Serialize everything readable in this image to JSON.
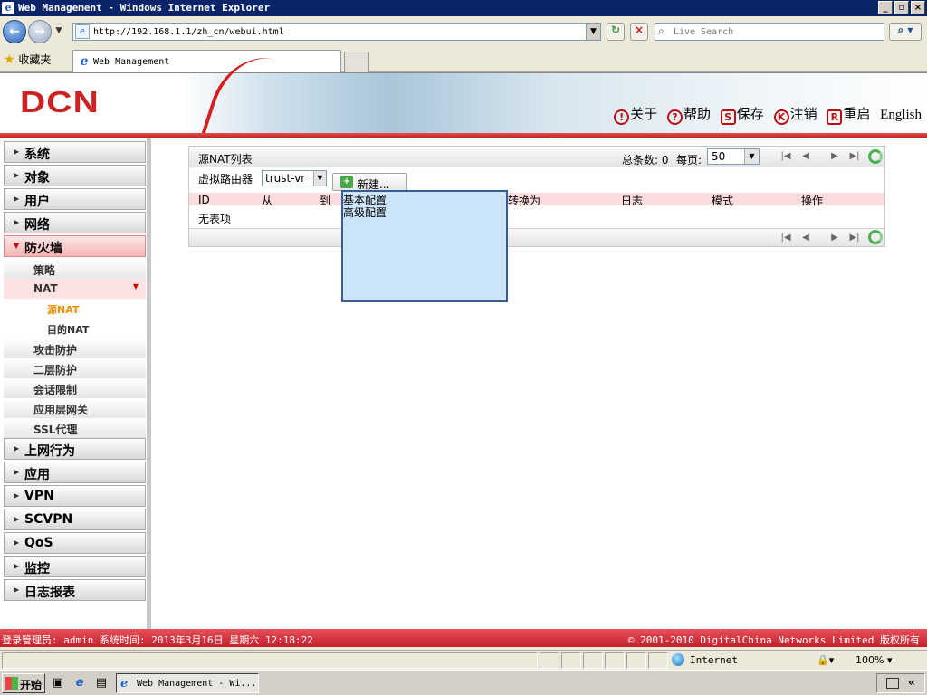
{
  "window": {
    "title": "Web Management - Windows Internet Explorer"
  },
  "browser": {
    "address": "http://192.168.1.1/zh_cn/webui.html",
    "search_placeholder": "Live Search",
    "favorites_label": "收藏夹",
    "tab_label": "Web Management"
  },
  "app": {
    "logo": "DCN",
    "header_links": [
      {
        "label": "关于",
        "icon": "!"
      },
      {
        "label": "帮助",
        "icon": "?"
      },
      {
        "label": "保存",
        "icon": "S"
      },
      {
        "label": "注销",
        "icon": "K"
      },
      {
        "label": "重启",
        "icon": "R"
      },
      {
        "label": "English"
      }
    ]
  },
  "sidebar": {
    "top_items": [
      "系统",
      "对象",
      "用户",
      "网络"
    ],
    "active_item": "防火墙",
    "firewall_subitems": [
      "策略",
      "NAT",
      "攻击防护",
      "二层防护",
      "会话限制",
      "应用层网关",
      "SSL代理"
    ],
    "nat_subitems": [
      "源NAT",
      "目的NAT"
    ],
    "bottom_items": [
      "上网行为",
      "应用",
      "VPN",
      "SCVPN",
      "QoS",
      "监控",
      "日志报表"
    ]
  },
  "panel": {
    "title": "源NAT列表",
    "total_label": "总条数: 0",
    "per_page_label": "每页:",
    "per_page_value": "50",
    "vr_label": "虚拟路由器",
    "vr_value": "trust-vr",
    "new_button": "新建...",
    "columns": [
      "ID",
      "从",
      "到",
      "转换为",
      "日志",
      "模式",
      "操作"
    ],
    "empty_text": "无表项",
    "new_menu": [
      "基本配置",
      "高级配置"
    ]
  },
  "status": {
    "left": "登录管理员: admin 系统时间: 2013年3月16日 星期六 12:18:22",
    "right": "© 2001-2010 DigitalChina Networks Limited 版权所有"
  },
  "iestatus": {
    "zone": "Internet",
    "zoom": "100%"
  },
  "taskbar": {
    "start": "开始",
    "task": "Web Management - Wi..."
  },
  "colors": {
    "brand_red": "#cc2222",
    "table_header": "#fbdcdc",
    "menu_bg": "#cce4f8",
    "active_orange": "#f08c00"
  }
}
